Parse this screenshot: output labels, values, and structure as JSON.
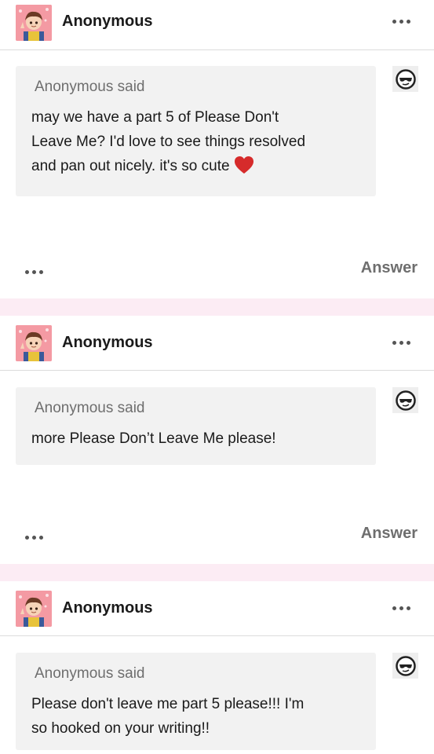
{
  "colors": {
    "separator": "#fcecf4",
    "bubble": "#f2f2f2",
    "muted_text": "#6e6e6e",
    "heart": "#d62b2b"
  },
  "posts": [
    {
      "author": "Anonymous",
      "asker_name": "Anonymous",
      "said": "said",
      "question_lines": [
        "may we have a part 5 of Please Don't",
        "Leave Me? I'd love to see things resolved",
        "and pan out nicely. it's so cute"
      ],
      "emoji": "red-heart",
      "answer_label": "Answer"
    },
    {
      "author": "Anonymous",
      "asker_name": "Anonymous",
      "said": "said",
      "question_lines": [
        "more Please Don’t Leave Me please!"
      ],
      "answer_label": "Answer"
    },
    {
      "author": "Anonymous",
      "asker_name": "Anonymous",
      "said": "said",
      "question_lines": [
        "Please don't leave me part 5 please!!! I'm",
        "so hooked on your writing!!"
      ]
    }
  ]
}
